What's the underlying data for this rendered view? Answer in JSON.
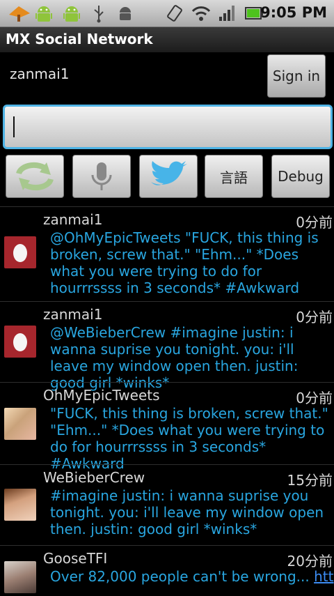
{
  "status_bar": {
    "time": "9:05 PM",
    "icons": [
      "flower-icon",
      "android-icon",
      "android-icon",
      "usb-icon",
      "android-debug-icon",
      "rotate-icon",
      "wifi-icon",
      "signal-icon",
      "battery-icon"
    ]
  },
  "app": {
    "title": "MX Social Network"
  },
  "account": {
    "username": "zanmai1",
    "sign_in_label": "Sign in"
  },
  "composer": {
    "value": ""
  },
  "toolbar": {
    "refresh_icon": "refresh-icon",
    "mic_icon": "microphone-icon",
    "twitter_icon": "twitter-bird-icon",
    "language_label": "言語",
    "debug_label": "Debug"
  },
  "tweets": [
    {
      "user": "zanmai1",
      "time": "0分前",
      "text": "@OhMyEpicTweets \"FUCK, this thing is broken, screw that.\" \"Ehm...\" *Does what you were trying to do for hourrrssss in 3 seconds* #Awkward",
      "avatar": "egg-avatar"
    },
    {
      "user": "zanmai1",
      "time": "0分前",
      "text": "@WeBieberCrew #imagine justin: i wanna suprise you tonight. you: i'll leave my window open then. justin: good girl *winks*",
      "avatar": "egg-avatar"
    },
    {
      "user": "OhMyEpicTweets",
      "time": "0分前",
      "text": "\"FUCK, this thing is broken, screw that.\" \"Ehm...\" *Does what you were trying to do for hourrrssss in 3 seconds* #Awkward",
      "avatar": "photo-avatar"
    },
    {
      "user": "WeBieberCrew",
      "time": "15分前",
      "text": "#imagine justin: i wanna suprise you tonight. you: i'll leave my window open then. justin: good girl *winks*",
      "avatar": "photo-avatar"
    },
    {
      "user": "GooseTFI",
      "time": "20分前",
      "text": "Over 82,000 people can't be wrong... ",
      "link": "http://",
      "avatar": "photo-avatar"
    }
  ]
}
